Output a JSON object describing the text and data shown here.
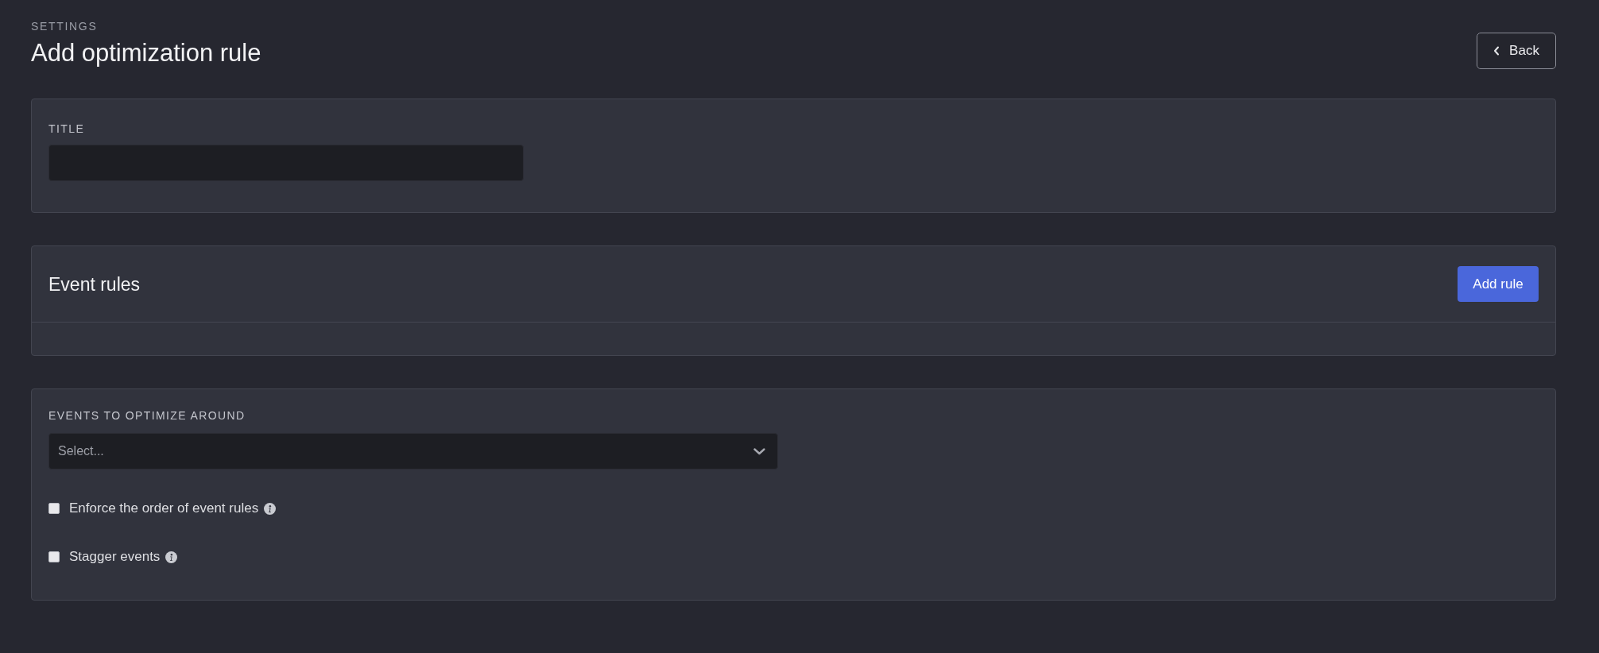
{
  "header": {
    "breadcrumb": "SETTINGS",
    "title": "Add optimization rule",
    "back_button": {
      "label": "Back"
    }
  },
  "title_section": {
    "label": "TITLE"
  },
  "event_rules": {
    "heading": "Event rules",
    "add_button": {
      "label": "Add rule"
    }
  },
  "events_section": {
    "label": "EVENTS TO OPTIMIZE AROUND",
    "select": {
      "placeholder": "Select..."
    },
    "options": [
      {
        "label": "Enforce the order of event rules",
        "checked": false,
        "info": true
      },
      {
        "label": "Stagger events",
        "checked": false,
        "info": true
      }
    ]
  }
}
